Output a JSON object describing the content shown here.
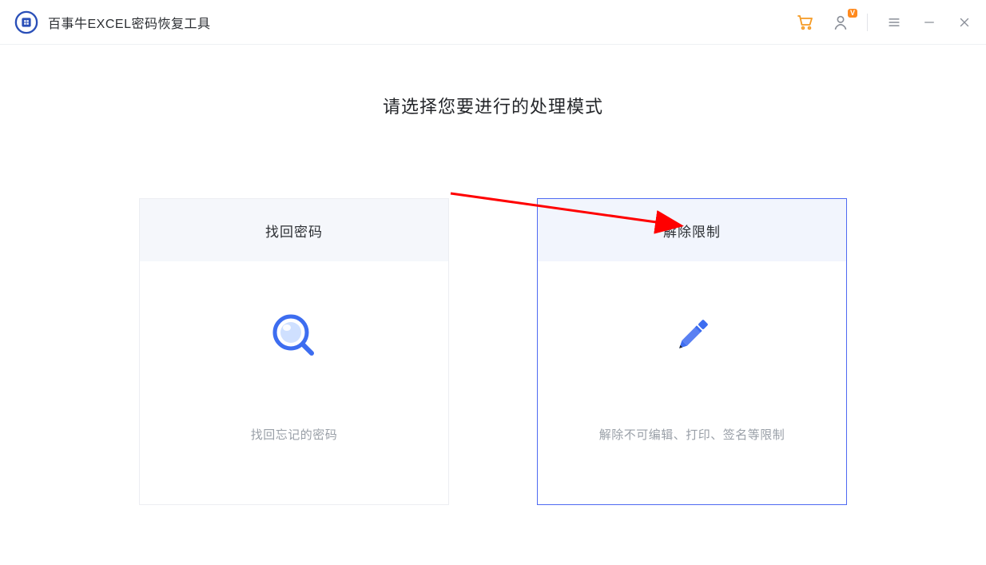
{
  "header": {
    "app_title": "百事牛EXCEL密码恢复工具",
    "icons": {
      "cart": "cart-icon",
      "account": "account-icon",
      "account_badge": "V",
      "menu": "menu-icon",
      "minimize": "minimize-icon",
      "close": "close-icon"
    }
  },
  "main": {
    "title": "请选择您要进行的处理模式",
    "cards": [
      {
        "id": "recover",
        "title": "找回密码",
        "description": "找回忘记的密码",
        "icon": "magnifier-icon",
        "selected": false
      },
      {
        "id": "unlock",
        "title": "解除限制",
        "description": "解除不可编辑、打印、签名等限制",
        "icon": "pencil-icon",
        "selected": true
      }
    ]
  },
  "colors": {
    "accent": "#4f6af2",
    "cart": "#f59a23",
    "icon_default": "#8a8f98"
  }
}
